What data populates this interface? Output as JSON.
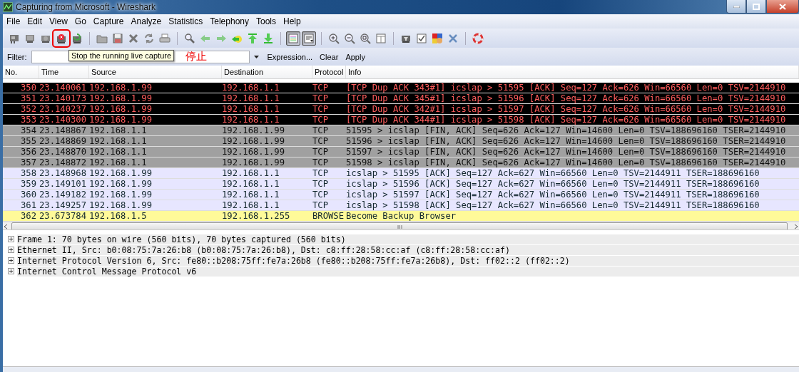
{
  "window": {
    "title": "Capturing from Microsoft - Wireshark"
  },
  "menu": [
    "File",
    "Edit",
    "View",
    "Go",
    "Capture",
    "Analyze",
    "Statistics",
    "Telephony",
    "Tools",
    "Help"
  ],
  "toolbar_groups": [
    [
      {
        "kind": "interfaces",
        "pressed": false,
        "highlighted": false
      },
      {
        "kind": "options",
        "pressed": false,
        "highlighted": false
      },
      {
        "kind": "start",
        "pressed": false,
        "highlighted": false
      },
      {
        "kind": "stop",
        "pressed": false,
        "highlighted": true
      },
      {
        "kind": "restart",
        "pressed": false,
        "highlighted": false
      }
    ],
    [
      {
        "kind": "open",
        "pressed": false,
        "highlighted": false
      },
      {
        "kind": "save",
        "pressed": false,
        "highlighted": false
      },
      {
        "kind": "close",
        "pressed": false,
        "highlighted": false
      },
      {
        "kind": "reload",
        "pressed": false,
        "highlighted": false
      },
      {
        "kind": "print",
        "pressed": false,
        "highlighted": false
      }
    ],
    [
      {
        "kind": "find",
        "pressed": false,
        "highlighted": false
      },
      {
        "kind": "back",
        "pressed": false,
        "highlighted": false
      },
      {
        "kind": "forward",
        "pressed": false,
        "highlighted": false
      },
      {
        "kind": "goto",
        "pressed": false,
        "highlighted": false
      },
      {
        "kind": "first",
        "pressed": false,
        "highlighted": false
      },
      {
        "kind": "last",
        "pressed": false,
        "highlighted": false
      }
    ],
    [
      {
        "kind": "colorize",
        "pressed": true,
        "highlighted": false
      },
      {
        "kind": "autoscroll",
        "pressed": true,
        "highlighted": false
      }
    ],
    [
      {
        "kind": "zoom-in",
        "pressed": false,
        "highlighted": false
      },
      {
        "kind": "zoom-out",
        "pressed": false,
        "highlighted": false
      },
      {
        "kind": "zoom-normal",
        "pressed": false,
        "highlighted": false
      },
      {
        "kind": "resize",
        "pressed": false,
        "highlighted": false
      }
    ],
    [
      {
        "kind": "capture-filters",
        "pressed": false,
        "highlighted": false
      },
      {
        "kind": "display-filters",
        "pressed": false,
        "highlighted": false
      },
      {
        "kind": "coloring-rules",
        "pressed": false,
        "highlighted": false
      },
      {
        "kind": "preferences",
        "pressed": false,
        "highlighted": false
      }
    ],
    [
      {
        "kind": "help",
        "pressed": false,
        "highlighted": false
      }
    ]
  ],
  "tooltip": "Stop the running live capture",
  "annotation": "停止",
  "filter": {
    "label": "Filter:",
    "buttons": [
      "Expression...",
      "Clear",
      "Apply"
    ]
  },
  "packet_list": {
    "columns": [
      "No.",
      "Time",
      "Source",
      "Destination",
      "Protocol",
      "Info"
    ],
    "rows": [
      {
        "kind": "dup-ack",
        "no": "350",
        "time": "23.140061",
        "source": "192.168.1.99",
        "destination": "192.168.1.1",
        "protocol": "TCP",
        "info": "[TCP Dup ACK 343#1] icslap > 51595 [ACK] Seq=127 Ack=626 Win=66560 Len=0 TSV=2144910"
      },
      {
        "kind": "dup-ack",
        "no": "351",
        "time": "23.140173",
        "source": "192.168.1.99",
        "destination": "192.168.1.1",
        "protocol": "TCP",
        "info": "[TCP Dup ACK 345#1] icslap > 51596 [ACK] Seq=127 Ack=626 Win=66560 Len=0 TSV=2144910"
      },
      {
        "kind": "dup-ack",
        "no": "352",
        "time": "23.140237",
        "source": "192.168.1.99",
        "destination": "192.168.1.1",
        "protocol": "TCP",
        "info": "[TCP Dup ACK 342#1] icslap > 51597 [ACK] Seq=127 Ack=626 Win=66560 Len=0 TSV=2144910"
      },
      {
        "kind": "dup-ack",
        "no": "353",
        "time": "23.140300",
        "source": "192.168.1.99",
        "destination": "192.168.1.1",
        "protocol": "TCP",
        "info": "[TCP Dup ACK 344#1] icslap > 51598 [ACK] Seq=127 Ack=626 Win=66560 Len=0 TSV=2144910"
      },
      {
        "kind": "fin",
        "no": "354",
        "time": "23.148867",
        "source": "192.168.1.1",
        "destination": "192.168.1.99",
        "protocol": "TCP",
        "info": "51595 > icslap [FIN, ACK] Seq=626 Ack=127 Win=14600 Len=0 TSV=188696160 TSER=2144910"
      },
      {
        "kind": "fin",
        "no": "355",
        "time": "23.148869",
        "source": "192.168.1.1",
        "destination": "192.168.1.99",
        "protocol": "TCP",
        "info": "51596 > icslap [FIN, ACK] Seq=626 Ack=127 Win=14600 Len=0 TSV=188696160 TSER=2144910"
      },
      {
        "kind": "fin",
        "no": "356",
        "time": "23.148870",
        "source": "192.168.1.1",
        "destination": "192.168.1.99",
        "protocol": "TCP",
        "info": "51597 > icslap [FIN, ACK] Seq=626 Ack=127 Win=14600 Len=0 TSV=188696160 TSER=2144910"
      },
      {
        "kind": "fin",
        "no": "357",
        "time": "23.148872",
        "source": "192.168.1.1",
        "destination": "192.168.1.99",
        "protocol": "TCP",
        "info": "51598 > icslap [FIN, ACK] Seq=626 Ack=127 Win=14600 Len=0 TSV=188696160 TSER=2144910"
      },
      {
        "kind": "ack",
        "no": "358",
        "time": "23.148968",
        "source": "192.168.1.99",
        "destination": "192.168.1.1",
        "protocol": "TCP",
        "info": "icslap > 51595 [ACK] Seq=127 Ack=627 Win=66560 Len=0 TSV=2144911 TSER=188696160"
      },
      {
        "kind": "ack",
        "no": "359",
        "time": "23.149101",
        "source": "192.168.1.99",
        "destination": "192.168.1.1",
        "protocol": "TCP",
        "info": "icslap > 51596 [ACK] Seq=127 Ack=627 Win=66560 Len=0 TSV=2144911 TSER=188696160"
      },
      {
        "kind": "ack",
        "no": "360",
        "time": "23.149182",
        "source": "192.168.1.99",
        "destination": "192.168.1.1",
        "protocol": "TCP",
        "info": "icslap > 51597 [ACK] Seq=127 Ack=627 Win=66560 Len=0 TSV=2144911 TSER=188696160"
      },
      {
        "kind": "ack",
        "no": "361",
        "time": "23.149257",
        "source": "192.168.1.99",
        "destination": "192.168.1.1",
        "protocol": "TCP",
        "info": "icslap > 51598 [ACK] Seq=127 Ack=627 Win=66560 Len=0 TSV=2144911 TSER=188696160"
      },
      {
        "kind": "browse",
        "no": "362",
        "time": "23.673784",
        "source": "192.168.1.5",
        "destination": "192.168.1.255",
        "protocol": "BROWSE",
        "info": "Become Backup Browser"
      }
    ]
  },
  "details": [
    {
      "text": "Frame 1: 70 bytes on wire (560 bits), 70 bytes captured (560 bits)",
      "expanded": false
    },
    {
      "text": "Ethernet II, Src: b0:08:75:7a:26:b8 (b0:08:75:7a:26:b8), Dst: c8:ff:28:58:cc:af (c8:ff:28:58:cc:af)",
      "expanded": false
    },
    {
      "text": "Internet Protocol Version 6, Src: fe80::b208:75ff:fe7a:26b8 (fe80::b208:75ff:fe7a:26b8), Dst: ff02::2 (ff02::2)",
      "expanded": false
    },
    {
      "text": "Internet Control Message Protocol v6",
      "expanded": false
    }
  ]
}
